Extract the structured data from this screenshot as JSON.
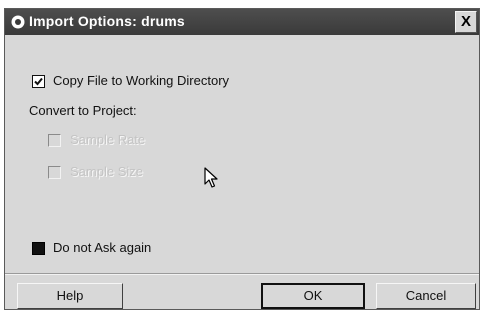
{
  "window": {
    "title": "Import Options: drums",
    "close_label": "X"
  },
  "options": {
    "copy_file": {
      "label": "Copy File to Working Directory",
      "checked": true
    },
    "convert_heading": "Convert to Project:",
    "sample_rate": {
      "label": "Sample Rate",
      "checked": false,
      "enabled": false
    },
    "sample_size": {
      "label": "Sample Size",
      "checked": false,
      "enabled": false
    },
    "do_not_ask": {
      "label": "Do not Ask again",
      "checked": true
    }
  },
  "buttons": {
    "help": "Help",
    "ok": "OK",
    "cancel": "Cancel"
  },
  "icons": {
    "title": "app-icon",
    "cursor": "mouse-pointer-icon"
  },
  "colors": {
    "title_bar": "#3a3a3a",
    "dialog_bg": "#d8d8d8",
    "disabled_text": "#c4c4c4"
  }
}
